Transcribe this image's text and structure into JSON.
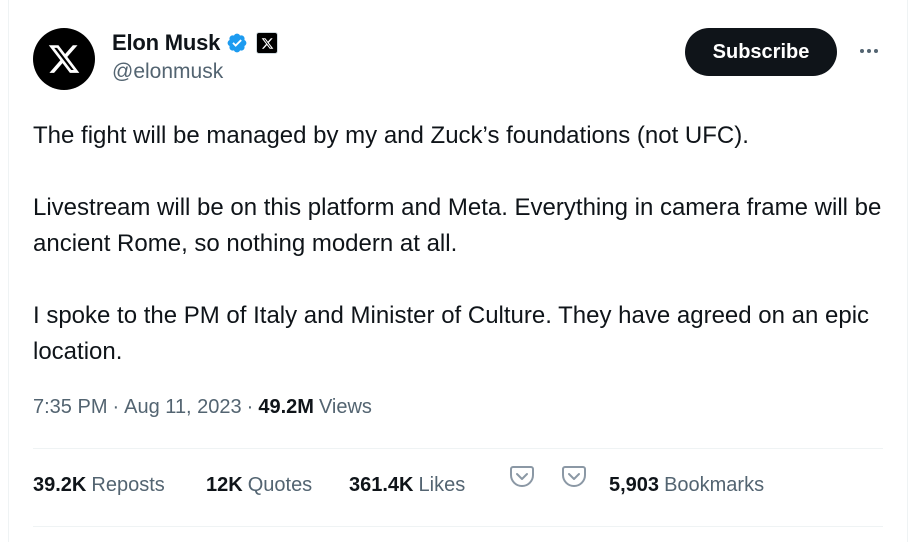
{
  "author": {
    "name": "Elon Musk",
    "handle": "@elonmusk",
    "avatar_icon": "x-logo-icon",
    "verified_icon": "verified-badge-icon",
    "affiliate_icon": "x-affiliate-icon"
  },
  "actions": {
    "subscribe_label": "Subscribe",
    "more_icon": "more-icon"
  },
  "tweet": {
    "paragraphs": [
      "The fight will be managed by my and Zuck’s foundations (not UFC).",
      "Livestream will be on this platform and Meta. Everything in camera frame will be ancient Rome, so nothing modern at all.",
      "I spoke to the PM of Italy and Minister of Culture. They have agreed on an epic location."
    ]
  },
  "meta": {
    "time": "7:35 PM",
    "separator": "·",
    "date": "Aug 11, 2023",
    "views_count": "49.2M",
    "views_label": "Views"
  },
  "stats": {
    "reposts": {
      "count": "39.2K",
      "label": "Reposts"
    },
    "quotes": {
      "count": "12K",
      "label": "Quotes"
    },
    "likes": {
      "count": "361.4K",
      "label": "Likes"
    },
    "bookmarks": {
      "count": "5,903",
      "label": "Bookmarks"
    }
  },
  "colors": {
    "text_primary": "#0f1419",
    "text_secondary": "#536471",
    "verified_blue": "#1d9bf0",
    "pocket_icon": "#8b98a5",
    "divider": "#eff3f4"
  }
}
